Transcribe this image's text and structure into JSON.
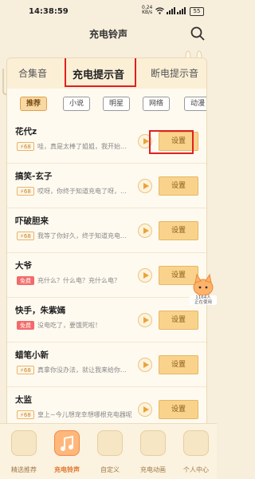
{
  "status_bar": {
    "time": "14:38:59",
    "speed_value": "0.24",
    "speed_unit": "KB/s",
    "battery": "55"
  },
  "header": {
    "title": "充电铃声"
  },
  "tabs": [
    {
      "label": "合集音"
    },
    {
      "label": "充电提示音"
    },
    {
      "label": "断电提示音"
    }
  ],
  "chips": [
    {
      "label": "推荐"
    },
    {
      "label": "小说"
    },
    {
      "label": "明星"
    },
    {
      "label": "网络"
    },
    {
      "label": "动漫"
    }
  ],
  "ringtones": [
    {
      "name": "花代z",
      "badge": "68",
      "desc": "哇，真是太棒了姐姐，我开始…",
      "button": "设置"
    },
    {
      "name": "搞笑-玄子",
      "badge": "68",
      "desc": "哎呀，你终于知道充电了呀，…",
      "button": "设置"
    },
    {
      "name": "吓破胆来",
      "badge": "68",
      "desc": "我等了你好久，终于知道充电…",
      "button": "设置"
    },
    {
      "name": "大爷",
      "badge": "免费",
      "desc": "充什么？什么电？充什么电？",
      "button": "设置"
    },
    {
      "name": "快手，朱紫嫣",
      "badge": "免费",
      "desc": "没电吃了，要饿死啦！",
      "button": "设置"
    },
    {
      "name": "蜡笔小新",
      "badge": "68",
      "desc": "真拿你没办法，就让我来给你…",
      "button": "设置"
    },
    {
      "name": "太监",
      "badge": "68",
      "desc": "皇上~今儿想宠幸想哪根充电器呢",
      "button": "设置"
    }
  ],
  "floating": {
    "count": "1164人",
    "sub": "正在使用"
  },
  "bottom_nav": [
    {
      "label": "精选推荐"
    },
    {
      "label": "充电铃声"
    },
    {
      "label": "自定义"
    },
    {
      "label": "充电动画"
    },
    {
      "label": "个人中心"
    }
  ],
  "colors": {
    "accent": "#e0732b",
    "button": "#f9d38c",
    "highlight": "#e0201f"
  }
}
